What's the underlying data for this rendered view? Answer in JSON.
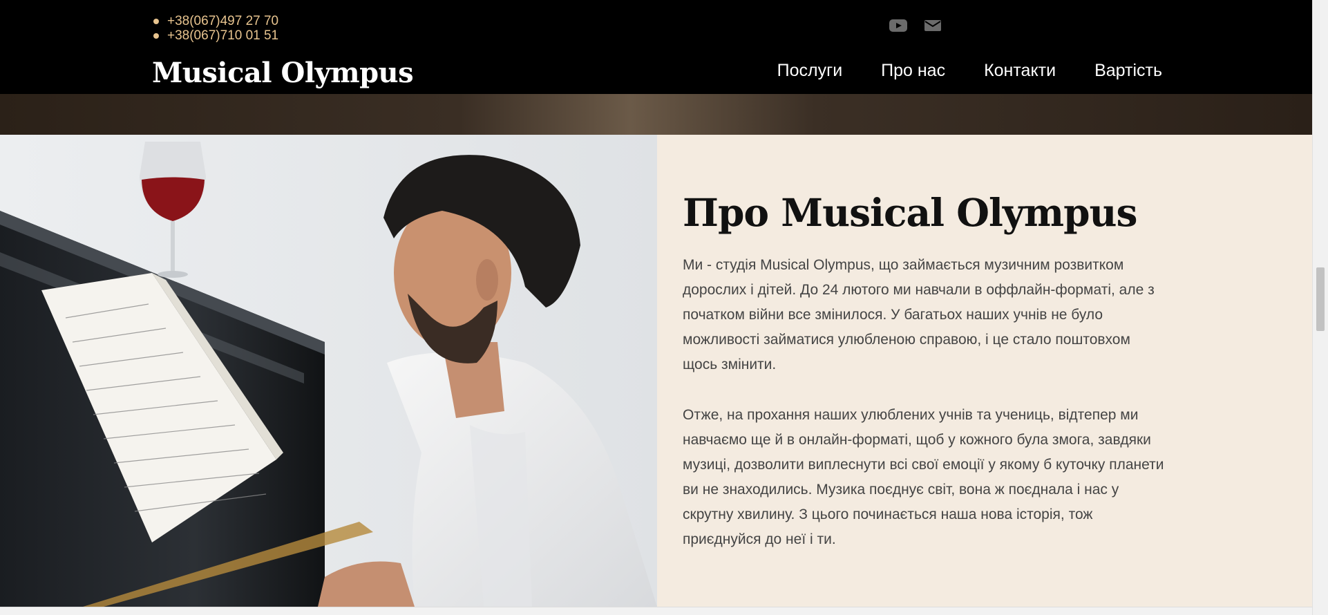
{
  "header": {
    "phones": [
      "+38(067)497 27 70",
      "+38(067)710 01 51"
    ],
    "social_icons": [
      "youtube-icon",
      "mail-icon"
    ],
    "brand": "Musical Olympus",
    "nav": [
      "Послуги",
      "Про нас",
      "Контакти",
      "Вартість"
    ]
  },
  "about": {
    "title": "Про Musical Olympus",
    "paragraph1": "Ми - студія Musical Olympus, що займається музичним розвитком дорослих і дітей. До 24 лютого ми навчали в оффлайн-форматі, але з початком війни все змінилося. У багатьох наших учнів не було можливості займатися улюбленою справою, і це стало поштовхом щось змінити.",
    "paragraph2": "Отже, на прохання наших улюблених учнів та учениць, відтепер ми навчаємо ще й в онлайн-форматі, щоб у кожного була змога, завдяки музиці, дозволити виплеснути всі свої емоції у якому б куточку планети ви не знаходились. Музика поєднує світ, вона ж поєднала і нас у скрутну хвилину. З цього починається наша нова історія, тож приєднуйся до неї і ти."
  },
  "colors": {
    "header_bg": "#000000",
    "accent_phone": "#e8c48f",
    "about_bg": "#f4ebe0",
    "title_text": "#111111",
    "body_text": "#444444"
  }
}
